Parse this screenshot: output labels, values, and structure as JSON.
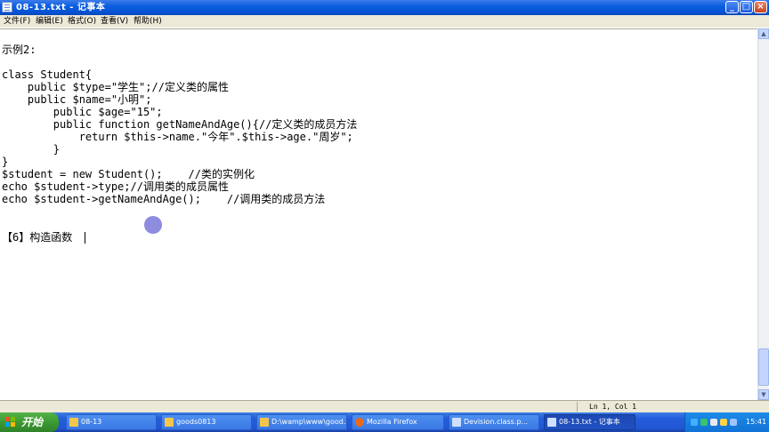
{
  "window": {
    "title": "08-13.txt - 记事本",
    "min_glyph": "_",
    "max_glyph": "□",
    "close_glyph": "×"
  },
  "menu": [
    "文件(F)",
    "编辑(E)",
    "格式(O)",
    "查看(V)",
    "帮助(H)"
  ],
  "editor": {
    "lines": [
      "示例2:",
      "",
      "class Student{",
      "    public $type=\"学生\";//定义类的属性",
      "    public $name=\"小明\";",
      "        public $age=\"15\";",
      "        public function getNameAndAge(){//定义类的成员方法",
      "            return $this->name.\"今年\".$this->age.\"周岁\";",
      "        }",
      "}",
      "$student = new Student();    //类的实例化",
      "echo $student->type;//调用类的成员属性",
      "echo $student->getNameAndAge();    //调用类的成员方法",
      "",
      "【6】构造函数"
    ]
  },
  "statusbar": {
    "position": "Ln 1, Col 1"
  },
  "taskbar": {
    "start_label": "开始",
    "tasks": [
      {
        "label": "08-13",
        "icon": "folder-icon",
        "color": "#f3c64b",
        "active": false
      },
      {
        "label": "goods0813",
        "icon": "folder-icon",
        "color": "#f3c64b",
        "active": false
      },
      {
        "label": "D:\\wamp\\www\\good...",
        "icon": "folder-icon",
        "color": "#f3c64b",
        "active": false
      },
      {
        "label": "Mozilla Firefox",
        "icon": "firefox-icon",
        "color": "#e86a1e",
        "active": false
      },
      {
        "label": "Devision.class.p...",
        "icon": "notepad-icon",
        "color": "#cfe0ff",
        "active": false
      },
      {
        "label": "08-13.txt - 记事本",
        "icon": "notepad-icon",
        "color": "#cfe0ff",
        "active": true
      }
    ],
    "clock": "15:41"
  }
}
